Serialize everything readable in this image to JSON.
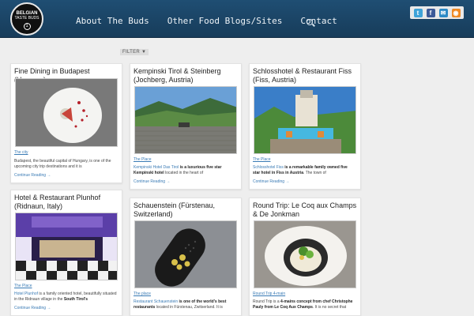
{
  "logo": {
    "line1": "BELGIAN",
    "line2": "TASTE BUDS",
    "badge": "1"
  },
  "nav": {
    "about": "About The Buds",
    "blogs": "Other Food Blogs/Sites",
    "contact": "Contact"
  },
  "icons": {
    "search": "search-icon",
    "social": [
      "twitter-icon",
      "facebook-icon",
      "email-icon",
      "rss-icon"
    ]
  },
  "colors": {
    "header": "#1b4566",
    "link": "#3a7bb5",
    "background": "#eeeeee"
  },
  "filter_label": "FILTER ▼",
  "cards": [
    {
      "title": "Fine Dining in Budapest (Hungary)",
      "category": "The city",
      "excerpt": "Budapest, the beautiful capital of Hungary, is one of the upcoming city trip destinations and it is",
      "more": "Continue Reading →"
    },
    {
      "title": "Kempinski Tirol & Steinberg (Jochberg, Austria)",
      "category": "The Place",
      "excerpt_link": "Kempinski Hotel Das Tirol",
      "excerpt_bold": " is a luxurious five star ",
      "excerpt_bold2": "Kempinski hotel",
      "excerpt_rest": " located in the heart of",
      "more": "Continue Reading →"
    },
    {
      "title": "Schlosshotel & Restaurant Fiss (Fiss, Austria)",
      "category": "The Place",
      "excerpt_link": "Schlosshotel Fiss",
      "excerpt_bold": " is a remarkable family owned five star hotel in Fiss in Austria",
      "excerpt_rest": ". The town of",
      "more": "Continue Reading →"
    },
    {
      "title": "Hotel & Restaurant Plunhof (Ridnaun, Italy)",
      "category": "The Place",
      "excerpt_link": "Hotel Plunhof",
      "excerpt_rest": " is a family oriented hotel, beautifully situated in the Ridnaun village in the ",
      "excerpt_bold": "South Tirol's",
      "more": "Continue Reading →"
    },
    {
      "title": "Schauenstein (Fürstenau, Switzerland)",
      "category": "The place",
      "excerpt_link": "Restaurant Schauenstein",
      "excerpt_bold": " is one of the world's best restaurants",
      "excerpt_rest": " located in Fürstenau, Zwitserland. It is"
    },
    {
      "title": "Round Trip: Le Coq aux Champs & De Jonkman",
      "category": "Round Trip 4-main",
      "excerpt_rest": "Round Trip is a ",
      "excerpt_bold": "4-mains concept from chef Christophe Pauly from Le Coq Aux Champs",
      "excerpt_rest2": ". It is no secret that"
    }
  ]
}
